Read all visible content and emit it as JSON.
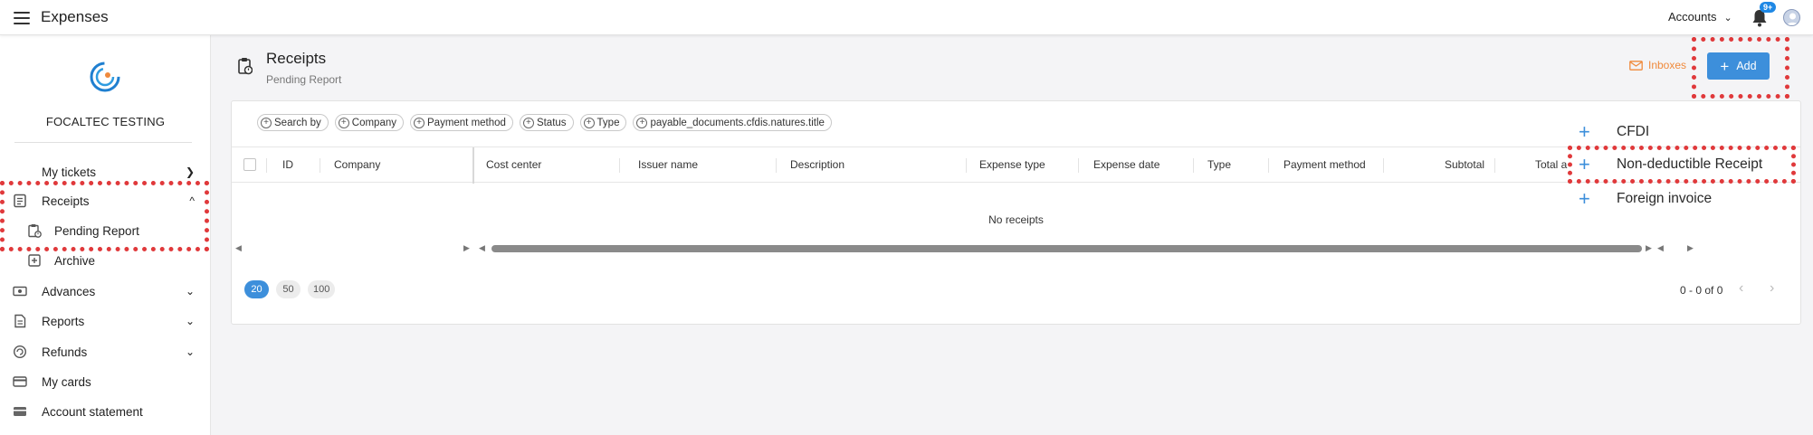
{
  "header": {
    "app_title": "Expenses",
    "accounts_label": "Accounts",
    "notification_badge": "9+"
  },
  "sidebar": {
    "company_name": "FOCALTEC TESTING",
    "items": [
      {
        "label": "My tickets",
        "icon": "tickets-icon",
        "expandable": true
      },
      {
        "label": "Receipts",
        "icon": "receipts-icon",
        "expandable": true,
        "expanded": true
      },
      {
        "label": "Pending Report",
        "icon": "pending-report-icon",
        "sub": true
      },
      {
        "label": "Archive",
        "icon": "archive-icon",
        "sub": true
      },
      {
        "label": "Advances",
        "icon": "advances-icon",
        "expandable": true
      },
      {
        "label": "Reports",
        "icon": "reports-icon",
        "expandable": true
      },
      {
        "label": "Refunds",
        "icon": "refunds-icon",
        "expandable": true
      },
      {
        "label": "My cards",
        "icon": "cards-icon"
      },
      {
        "label": "Account statement",
        "icon": "account-statement-icon"
      }
    ]
  },
  "page": {
    "title": "Receipts",
    "subtitle": "Pending Report",
    "inboxes_label": "Inboxes",
    "add_label": "Add"
  },
  "filters": [
    "Search by",
    "Company",
    "Payment method",
    "Status",
    "Type",
    "payable_documents.cfdis.natures.title"
  ],
  "table": {
    "columns": [
      "ID",
      "Company",
      "Cost center",
      "Issuer name",
      "Description",
      "Expense type",
      "Expense date",
      "Type",
      "Payment method",
      "Subtotal",
      "Total a"
    ],
    "empty_message": "No receipts"
  },
  "pagination": {
    "sizes": [
      "20",
      "50",
      "100"
    ],
    "active_size": "20",
    "range": "0 - 0 of 0"
  },
  "add_menu": {
    "items": [
      "CFDI",
      "Non-deductible Receipt",
      "Foreign invoice"
    ]
  },
  "colors": {
    "accent": "#3d8fdb",
    "inboxes": "#f08a3c",
    "highlight": "#e0393b"
  }
}
